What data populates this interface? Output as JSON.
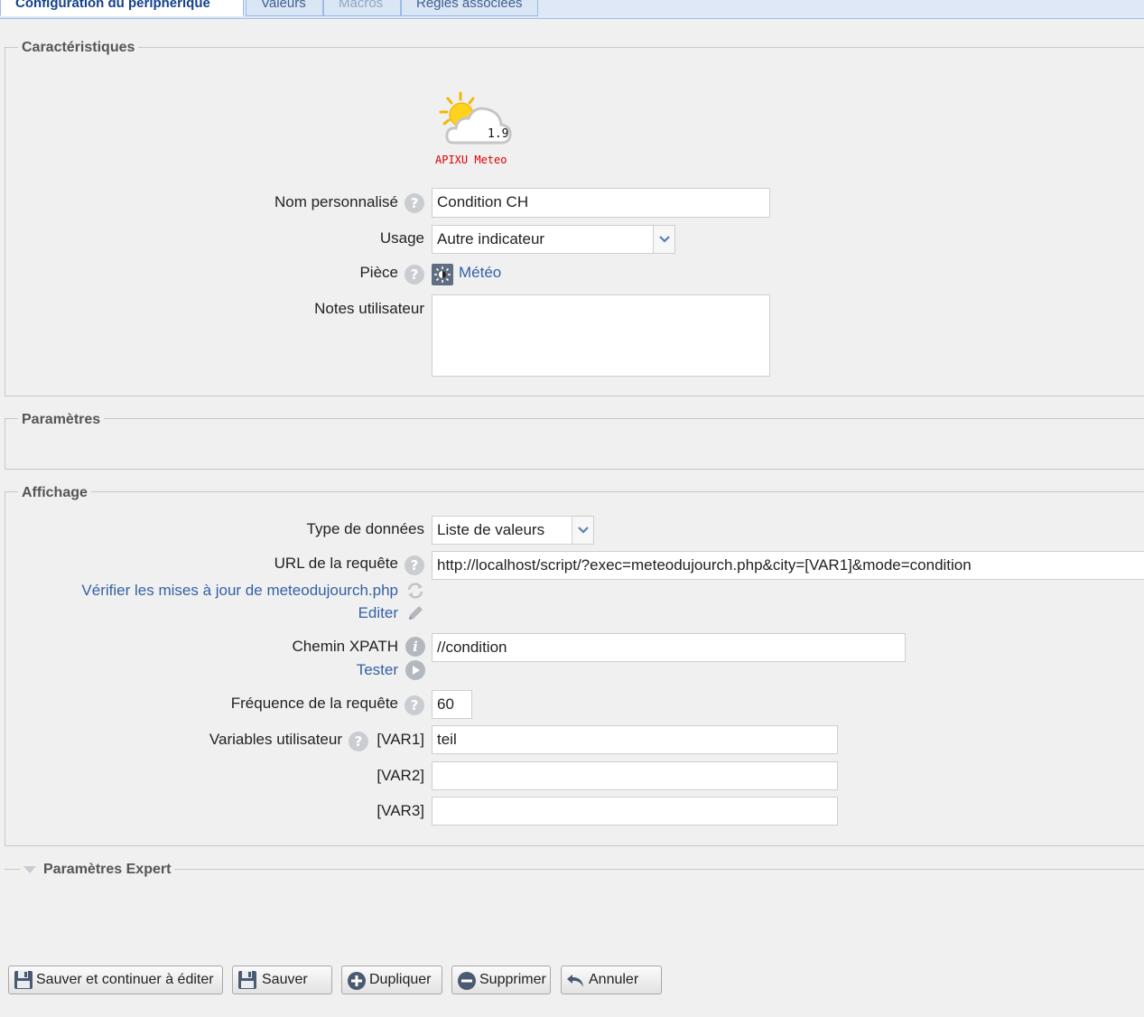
{
  "tabs": [
    {
      "label": "Configuration du périphérique",
      "state": "active"
    },
    {
      "label": "Valeurs",
      "state": "normal"
    },
    {
      "label": "Macros",
      "state": "disabled"
    },
    {
      "label": "Règles associées",
      "state": "normal"
    }
  ],
  "caracteristiques": {
    "legend": "Caractéristiques",
    "plugin": {
      "version": "1.9",
      "name": "APIXU Meteo",
      "name_color": "#e00000",
      "icon": "sun-cloud-icon"
    },
    "nom_label": "Nom personnalisé",
    "nom_value": "Condition CH",
    "usage_label": "Usage",
    "usage_value": "Autre indicateur",
    "piece_label": "Pièce",
    "piece_value": "Météo",
    "notes_label": "Notes utilisateur",
    "notes_value": ""
  },
  "parametres": {
    "legend": "Paramètres"
  },
  "affichage": {
    "legend": "Affichage",
    "type_label": "Type de données",
    "type_value": "Liste de valeurs",
    "url_label": "URL de la requête",
    "url_value": "http://localhost/script/?exec=meteodujourch.php&city=[VAR1]&mode=condition",
    "verifier_link": "Vérifier les mises à jour de meteodujourch.php",
    "editer_link": "Editer",
    "xpath_label": "Chemin XPATH",
    "xpath_value": "//condition",
    "tester_link": "Tester",
    "freq_label": "Fréquence de la requête",
    "freq_value": "60",
    "vars_label": "Variables utilisateur",
    "vars": [
      {
        "name": "[VAR1]",
        "value": "teil"
      },
      {
        "name": "[VAR2]",
        "value": ""
      },
      {
        "name": "[VAR3]",
        "value": ""
      }
    ]
  },
  "expert": {
    "legend": "Paramètres Expert"
  },
  "buttons": {
    "save_continue": "Sauver et continuer à éditer",
    "save": "Sauver",
    "duplicate": "Dupliquer",
    "delete": "Supprimer",
    "cancel": "Annuler"
  },
  "colors": {
    "link": "#3461a5",
    "tab_active": "#15428b",
    "plugin_name": "#e00000"
  }
}
